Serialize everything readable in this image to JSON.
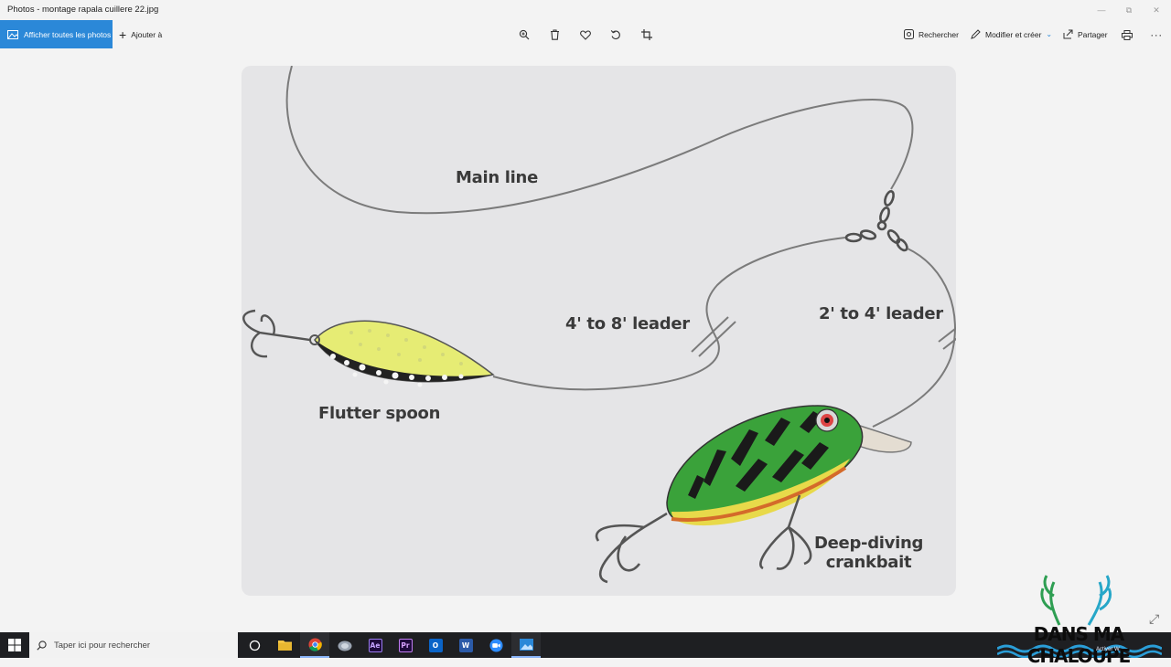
{
  "window": {
    "title": "Photos - montage rapala cuillere 22.jpg",
    "controls": [
      {
        "name": "minimize",
        "glyph": "—"
      },
      {
        "name": "maximize",
        "glyph": "⧉"
      },
      {
        "name": "close",
        "glyph": "✕"
      }
    ]
  },
  "toolbar": {
    "all_photos": "Afficher toutes les photos",
    "add_to": "Ajouter à",
    "center_icons": [
      "zoom-icon",
      "delete-icon",
      "favorite-icon",
      "rotate-icon",
      "crop-icon"
    ],
    "search": "Rechercher",
    "edit_create": "Modifier et créer",
    "share": "Partager",
    "print_icon": "print-icon",
    "more_icon": "more-icon",
    "accent": "#2b88d8"
  },
  "image": {
    "labels": {
      "main_line": "Main line",
      "leader_long": "4' to 8' leader",
      "leader_short": "2' to 4' leader",
      "flutter_spoon": "Flutter spoon",
      "crankbait_line1": "Deep-diving",
      "crankbait_line2": "crankbait"
    }
  },
  "taskbar": {
    "search_placeholder": "Taper ici pour rechercher",
    "apps": [
      {
        "name": "task-view",
        "label": ""
      },
      {
        "name": "file-explorer",
        "label": ""
      },
      {
        "name": "chrome",
        "label": ""
      },
      {
        "name": "photo-editor",
        "label": ""
      },
      {
        "name": "after-effects",
        "label": "Ae"
      },
      {
        "name": "premiere-pro",
        "label": "Pr"
      },
      {
        "name": "outlook",
        "label": "O"
      },
      {
        "name": "word",
        "label": "W"
      },
      {
        "name": "zoom",
        "label": ""
      },
      {
        "name": "photos",
        "label": ""
      }
    ]
  },
  "watermark": {
    "text": "DANS MA CHALOUPE",
    "sub": "Activer W"
  }
}
